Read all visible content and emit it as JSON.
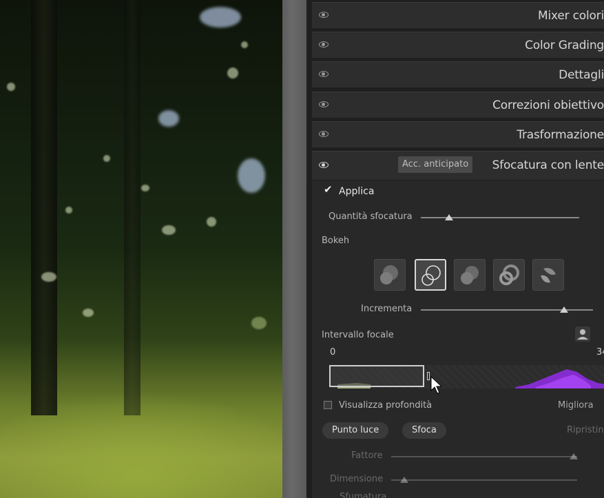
{
  "panel": {
    "sections": [
      {
        "title": "Mixer colori"
      },
      {
        "title": "Color Grading"
      },
      {
        "title": "Dettagli"
      },
      {
        "title": "Correzioni obiettivo"
      },
      {
        "title": "Trasformazione"
      }
    ],
    "lens_blur": {
      "title": "Sfocatura con lente",
      "badge": "Acc. anticipato",
      "apply_label": "Applica",
      "apply_checked": true,
      "blur_amount_label": "Quantità sfocatura",
      "blur_amount_value": 0.18,
      "bokeh_label": "Bokeh",
      "bokeh_shapes": [
        "circle-bokeh-icon",
        "ring-bokeh-icon",
        "blade-bokeh-icon",
        "donut-bokeh-icon",
        "cat-eye-bokeh-icon"
      ],
      "bokeh_selected_index": 1,
      "boost_label": "Incrementa",
      "boost_value": 0.83,
      "focal_range_label": "Intervallo focale",
      "focal_min": "0",
      "focal_max_partial": "34",
      "show_depth_label": "Visualizza profondità",
      "refine_label": "Migliora",
      "highlight_button": "Punto luce",
      "blur_button": "Sfoca",
      "reset_label": "Ripristin",
      "factor_label": "Fattore",
      "factor_value": 0.98,
      "size_label": "Dimensione",
      "size_value": 0.07,
      "next_label_partial": "Sfumatura"
    }
  },
  "colors": {
    "panel_bg": "#282828",
    "section_bg": "#2d2d2d",
    "histogram_accent": "#8a2be2"
  }
}
